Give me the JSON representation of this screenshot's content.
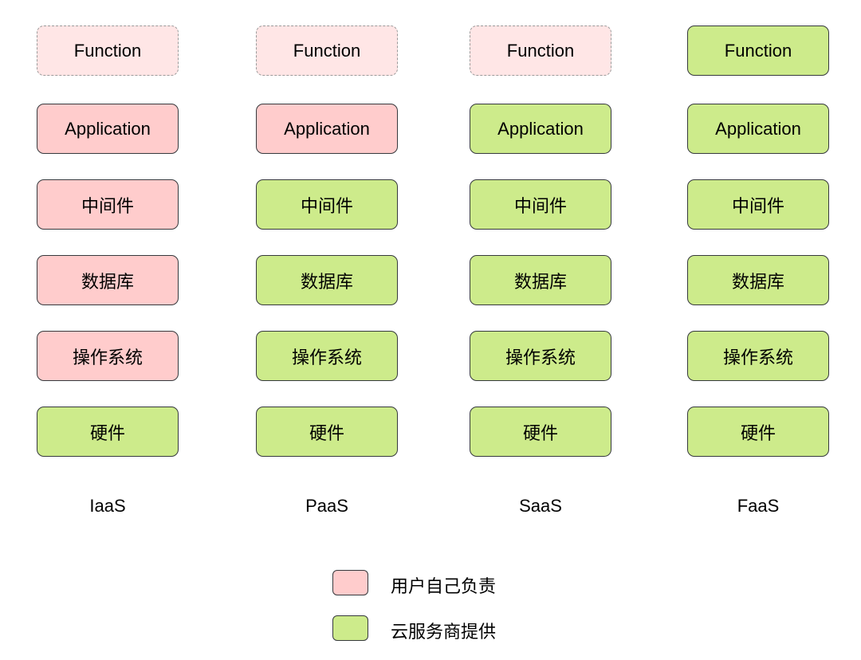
{
  "colors": {
    "user": "#FFCCCC",
    "cloud": "#CDEB8B",
    "not_applicable": "#FFE6E6"
  },
  "columns": [
    {
      "label": "IaaS",
      "layers": [
        {
          "text": "Function",
          "owner": "na"
        },
        {
          "text": "Application",
          "owner": "user"
        },
        {
          "text": "中间件",
          "owner": "user"
        },
        {
          "text": "数据库",
          "owner": "user"
        },
        {
          "text": "操作系统",
          "owner": "user"
        },
        {
          "text": "硬件",
          "owner": "cloud"
        }
      ]
    },
    {
      "label": "PaaS",
      "layers": [
        {
          "text": "Function",
          "owner": "na"
        },
        {
          "text": "Application",
          "owner": "user"
        },
        {
          "text": "中间件",
          "owner": "cloud"
        },
        {
          "text": "数据库",
          "owner": "cloud"
        },
        {
          "text": "操作系统",
          "owner": "cloud"
        },
        {
          "text": "硬件",
          "owner": "cloud"
        }
      ]
    },
    {
      "label": "SaaS",
      "layers": [
        {
          "text": "Function",
          "owner": "na"
        },
        {
          "text": "Application",
          "owner": "cloud"
        },
        {
          "text": "中间件",
          "owner": "cloud"
        },
        {
          "text": "数据库",
          "owner": "cloud"
        },
        {
          "text": "操作系统",
          "owner": "cloud"
        },
        {
          "text": "硬件",
          "owner": "cloud"
        }
      ]
    },
    {
      "label": "FaaS",
      "layers": [
        {
          "text": "Function",
          "owner": "cloud"
        },
        {
          "text": "Application",
          "owner": "cloud"
        },
        {
          "text": "中间件",
          "owner": "cloud"
        },
        {
          "text": "数据库",
          "owner": "cloud"
        },
        {
          "text": "操作系统",
          "owner": "cloud"
        },
        {
          "text": "硬件",
          "owner": "cloud"
        }
      ]
    }
  ],
  "legend": [
    {
      "text": "用户自己负责",
      "owner": "user"
    },
    {
      "text": "云服务商提供",
      "owner": "cloud"
    }
  ]
}
